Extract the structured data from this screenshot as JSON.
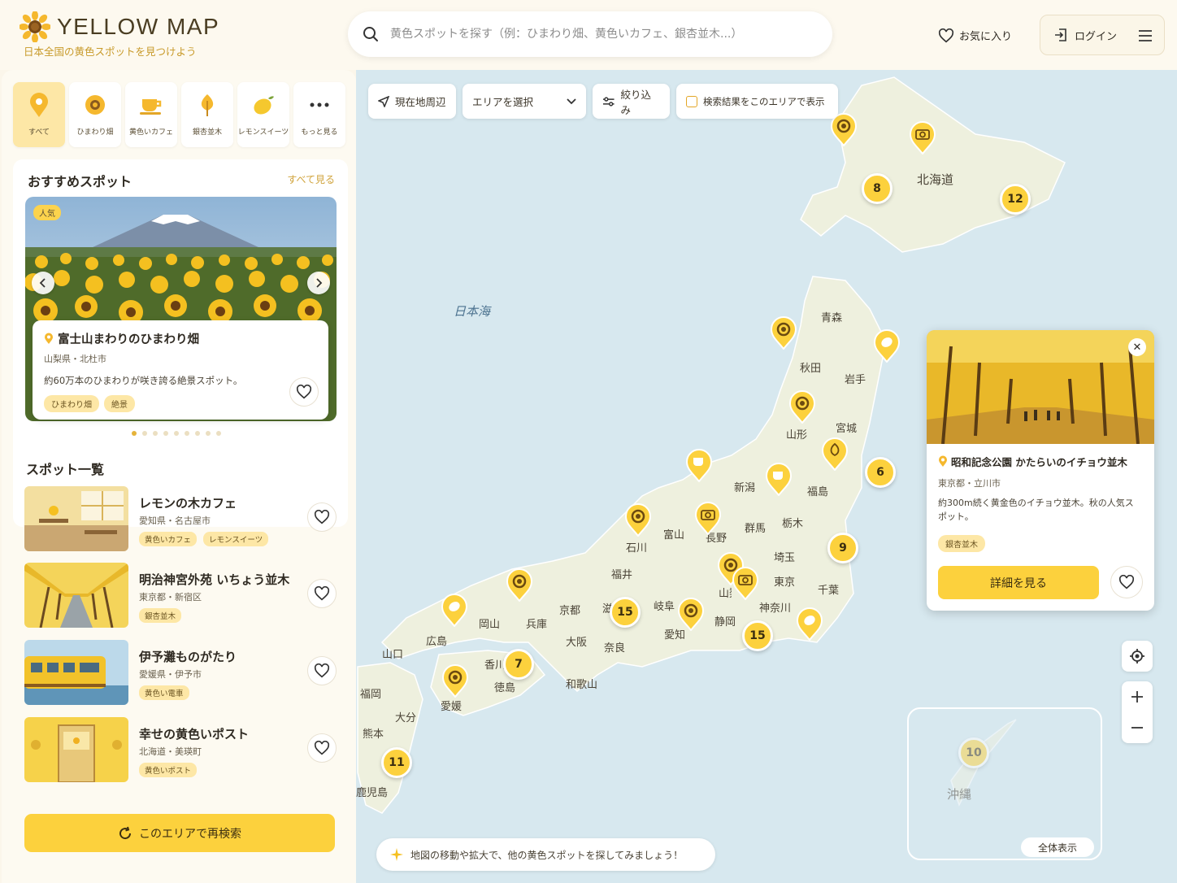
{
  "header": {
    "logo_title": "YELLOW MAP",
    "logo_subtitle": "日本全国の黄色スポットを見つけよう",
    "search_placeholder": "黄色スポットを探す（例：ひまわり畑、黄色いカフェ、銀杏並木...）",
    "favorites_label": "お気に入り",
    "login_label": "ログイン"
  },
  "categories": [
    {
      "label": "すべて",
      "icon": "pin-icon",
      "active": true
    },
    {
      "label": "ひまわり畑",
      "icon": "sunflower-icon"
    },
    {
      "label": "黄色いカフェ",
      "icon": "cafe-icon"
    },
    {
      "label": "銀杏並木",
      "icon": "ginkgo-icon"
    },
    {
      "label": "レモンスイーツ",
      "icon": "lemon-icon"
    },
    {
      "label": "もっと見る",
      "icon": "more-icon"
    }
  ],
  "recommended": {
    "title": "おすすめスポット",
    "see_all": "すべて見る",
    "badge": "人気",
    "spot": {
      "name": "富士山まわりのひまわり畑",
      "location": "山梨県・北杜市",
      "description": "約60万本のひまわりが咲き誇る絶景スポット。",
      "tags": [
        "ひまわり畑",
        "絶景"
      ]
    },
    "dots_total": 9,
    "dots_active": 1
  },
  "list": {
    "title": "スポット一覧",
    "items": [
      {
        "name": "レモンの木カフェ",
        "location": "愛知県・名古屋市",
        "tags": [
          "黄色いカフェ",
          "レモンスイーツ"
        ]
      },
      {
        "name": "明治神宮外苑 いちょう並木",
        "location": "東京都・新宿区",
        "tags": [
          "銀杏並木"
        ]
      },
      {
        "name": "伊予灘ものがたり",
        "location": "愛媛県・伊予市",
        "tags": [
          "黄色い電車"
        ]
      },
      {
        "name": "幸せの黄色いポスト",
        "location": "北海道・美瑛町",
        "tags": [
          "黄色いポスト"
        ]
      }
    ]
  },
  "research_button": "このエリアで再検索",
  "map_toolbar": {
    "near_me": "現在地周辺",
    "area_select": "エリアを選択",
    "filter": "絞り込み",
    "show_in_area": "検索結果をこのエリアで表示"
  },
  "map_labels": {
    "sea": "日本海",
    "hokkaido": "北海道",
    "aomori": "青森",
    "akita": "秋田",
    "iwate": "岩手",
    "miyagi": "宮城",
    "yamagata": "山形",
    "fukushima": "福島",
    "niigata": "新潟",
    "tochigi": "栃木",
    "gunma": "群馬",
    "nagano": "長野",
    "toyama": "富山",
    "ishikawa": "石川",
    "fukui": "福井",
    "saitama": "埼玉",
    "tokyo": "東京",
    "chiba": "千葉",
    "kanagawa": "神奈川",
    "yamanashi": "山梨",
    "shizuoka": "静岡",
    "gifu": "岐阜",
    "aichi": "愛知",
    "kyoto": "京都",
    "shiga": "滋賀",
    "hyogo": "兵庫",
    "osaka": "大阪",
    "nara": "奈良",
    "wakayama": "和歌山",
    "okayama": "岡山",
    "hiroshima": "広島",
    "yamaguchi": "山口",
    "kagawa": "香川",
    "tokushima": "徳島",
    "ehime": "愛媛",
    "fukuoka": "福岡",
    "oita": "大分",
    "kumamoto": "熊本",
    "kagoshima": "鹿児島",
    "okinawa": "沖縄"
  },
  "clusters": [
    "8",
    "12",
    "6",
    "9",
    "15",
    "15",
    "7",
    "11",
    "10"
  ],
  "popup": {
    "name": "昭和記念公園 かたらいのイチョウ並木",
    "location": "東京都・立川市",
    "description": "約300m続く黄金色のイチョウ並木。秋の人気スポット。",
    "tag": "銀杏並木",
    "detail_button": "詳細を見る"
  },
  "inset_button": "全体表示",
  "hint": "地図の移動や拡大で、他の黄色スポットを探してみましょう！",
  "colors": {
    "accent": "#fcd13d",
    "background": "#fbf6ea",
    "sea": "#d7e8ef",
    "land": "#eef0de"
  }
}
